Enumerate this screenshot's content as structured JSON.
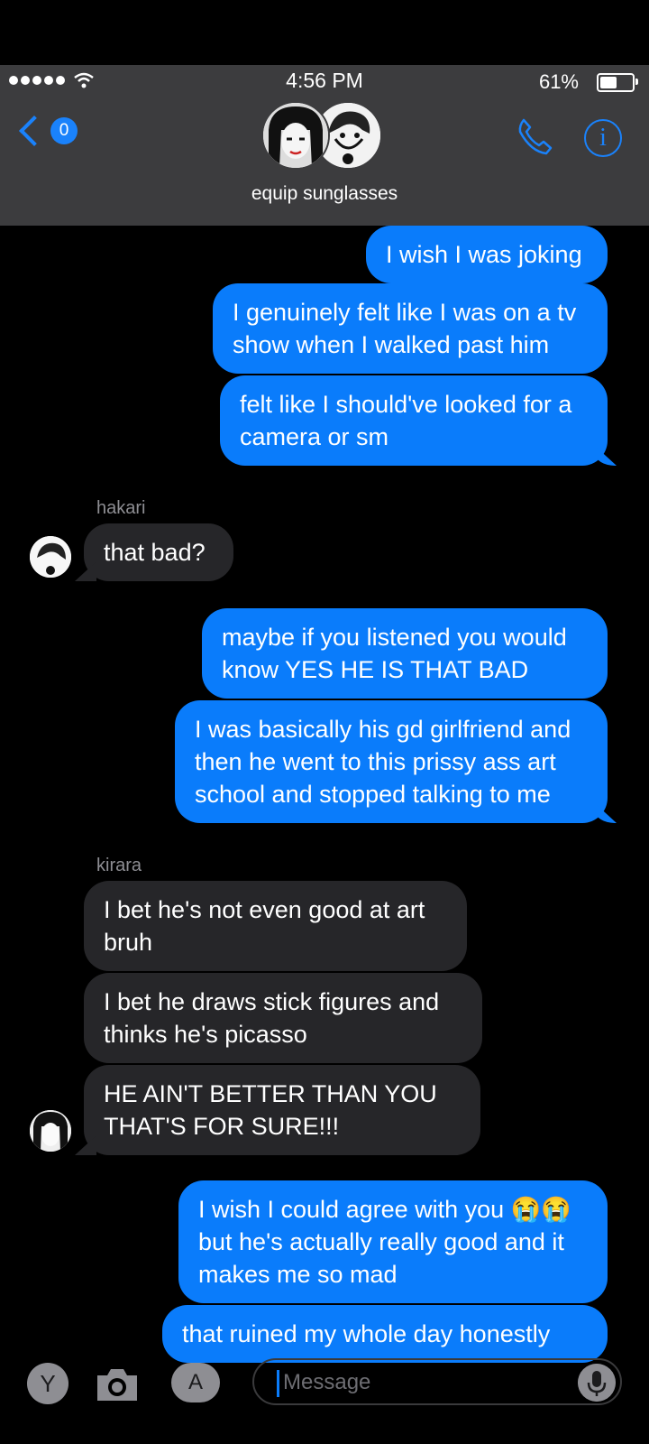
{
  "status_bar": {
    "time": "4:56 PM",
    "battery": "61%",
    "battery_level": 0.61
  },
  "header": {
    "back_count": "0",
    "group_name": "equip sunglasses"
  },
  "messages": [
    {
      "from": "me",
      "text": "I wish I was joking"
    },
    {
      "from": "me",
      "text": "I genuinely felt like I was on a tv show when I walked past him"
    },
    {
      "from": "me",
      "text": "felt like I should've looked for a camera or sm"
    },
    {
      "from": "hakari",
      "sender_label": "hakari",
      "text": "that bad?"
    },
    {
      "from": "me",
      "text": "maybe if you listened you would know YES HE IS THAT BAD"
    },
    {
      "from": "me",
      "text": "I was basically his gd girlfriend and then he went to this prissy ass art school and stopped talking to me"
    },
    {
      "from": "kirara",
      "sender_label": "kirara",
      "text": "I bet he's not even good at art bruh"
    },
    {
      "from": "kirara",
      "text": "I bet he draws stick figures and thinks he's picasso"
    },
    {
      "from": "kirara",
      "text": "HE AIN'T BETTER THAN YOU THAT'S FOR SURE!!!"
    },
    {
      "from": "me",
      "text": "I wish I could agree with you 😭😭 but he's actually really good and it makes me so mad"
    },
    {
      "from": "me",
      "text": "that ruined my whole day honestly"
    }
  ],
  "input": {
    "placeholder": "Message",
    "left_button": "Y"
  },
  "colors": {
    "outgoing": "#0a7cfb",
    "incoming": "#262629",
    "accent": "#1a82fb",
    "header": "#3c3c3e"
  },
  "icons": [
    "signal-icon",
    "wifi-icon",
    "battery-icon",
    "back-chevron-icon",
    "phone-icon",
    "info-icon",
    "camera-icon",
    "app-store-icon",
    "microphone-icon"
  ]
}
